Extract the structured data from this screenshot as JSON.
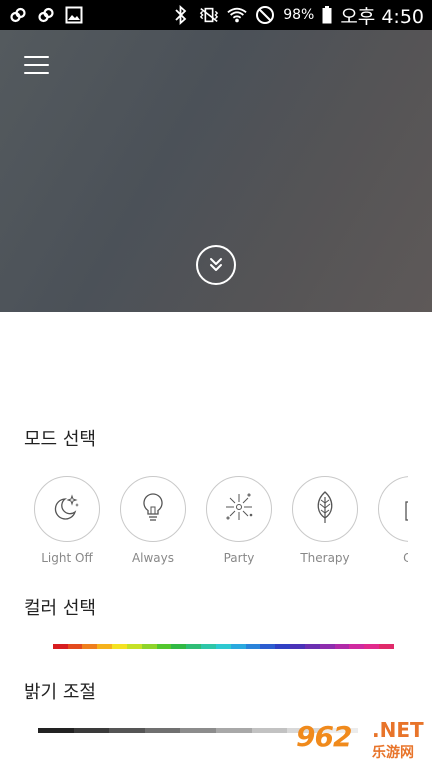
{
  "status_bar": {
    "battery": "98%",
    "time": "오후 4:50",
    "icons": [
      "link-icon",
      "link-icon",
      "image-icon",
      "bluetooth-icon",
      "vibrate-icon",
      "wifi-icon",
      "do-not-disturb-icon",
      "battery-icon"
    ]
  },
  "hero": {
    "menu_icon": "hamburger-menu-icon",
    "expand_icon": "double-chevron-down-icon",
    "gradient_colors": [
      "#545a5e",
      "#4b5158",
      "#555456",
      "#5e5958"
    ]
  },
  "mode_section": {
    "title": "모드 선택",
    "modes": [
      {
        "label": "Light Off",
        "icon": "moon-stars-icon"
      },
      {
        "label": "Always",
        "icon": "lightbulb-icon"
      },
      {
        "label": "Party",
        "icon": "firework-icon"
      },
      {
        "label": "Therapy",
        "icon": "leaf-icon"
      },
      {
        "label": "Ca",
        "icon": "candle-icon"
      }
    ]
  },
  "color_section": {
    "title": "컬러 선택",
    "palette": [
      "#ffffff",
      "#d71d20",
      "#e34a1e",
      "#ef7f1d",
      "#f5b21c",
      "#f4e222",
      "#c5e126",
      "#8fd42a",
      "#53c72e",
      "#31b944",
      "#2fbd76",
      "#2ec6a8",
      "#2ec9d1",
      "#2aa9df",
      "#2a83da",
      "#2c5dd0",
      "#3040c4",
      "#4a32b8",
      "#6b2fb1",
      "#8e2dae",
      "#b02aa8",
      "#cf2aa0",
      "#e12a8c",
      "#e02a6a"
    ]
  },
  "brightness_section": {
    "title": "밝기 조절",
    "levels": [
      "#222222",
      "#3a3a3a",
      "#555555",
      "#707070",
      "#8c8c8c",
      "#a8a8a8",
      "#c2c2c2",
      "#d8d8d8",
      "#ececec",
      "#ffffff"
    ]
  },
  "watermark": {
    "number": "962",
    "domain": ".NET",
    "text": "乐游网"
  }
}
